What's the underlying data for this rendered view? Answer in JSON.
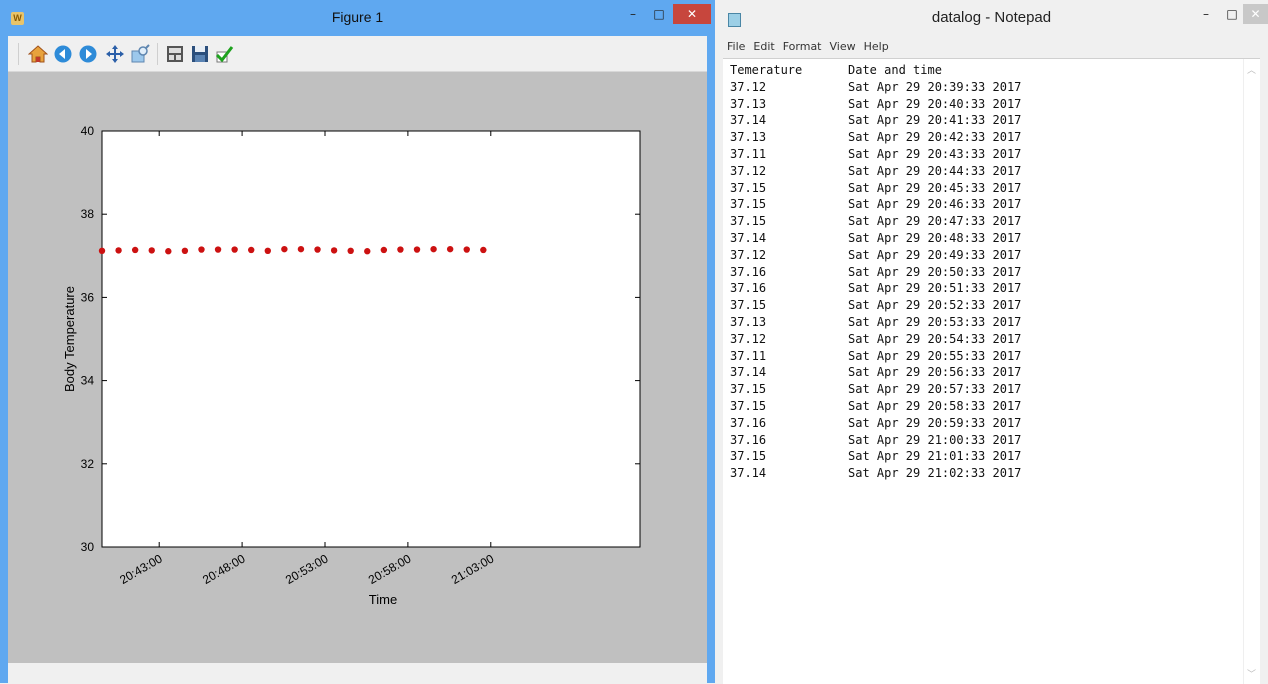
{
  "figure_window": {
    "title": "Figure 1",
    "app_icon_text": "W",
    "minimize": "–",
    "maximize": "□",
    "close": "✕",
    "toolbar": [
      {
        "name": "home-icon",
        "interactable": true
      },
      {
        "name": "back-icon",
        "interactable": true
      },
      {
        "name": "forward-icon",
        "interactable": true
      },
      {
        "name": "pan-icon",
        "interactable": true
      },
      {
        "name": "zoom-icon",
        "interactable": true
      },
      {
        "name": "subplots-icon",
        "interactable": true
      },
      {
        "name": "save-icon",
        "interactable": true
      },
      {
        "name": "edit-check-icon",
        "interactable": true
      }
    ]
  },
  "chart_data": {
    "type": "scatter",
    "title": "",
    "xlabel": "Time",
    "ylabel": "Body Temperature",
    "ylim": [
      30,
      40
    ],
    "yticks": [
      30,
      32,
      34,
      36,
      38,
      40
    ],
    "xlim": [
      "20:39:33",
      "21:12:00"
    ],
    "xticks": [
      "20:43:00",
      "20:48:00",
      "20:53:00",
      "20:58:00",
      "21:03:00"
    ],
    "grid": false,
    "marker_color": "#cc1111",
    "series": [
      {
        "x": [
          "20:39:33",
          "20:40:33",
          "20:41:33",
          "20:42:33",
          "20:43:33",
          "20:44:33",
          "20:45:33",
          "20:46:33",
          "20:47:33",
          "20:48:33",
          "20:49:33",
          "20:50:33",
          "20:51:33",
          "20:52:33",
          "20:53:33",
          "20:54:33",
          "20:55:33",
          "20:56:33",
          "20:57:33",
          "20:58:33",
          "20:59:33",
          "21:00:33",
          "21:01:33",
          "21:02:33"
        ],
        "y": [
          37.12,
          37.13,
          37.14,
          37.13,
          37.11,
          37.12,
          37.15,
          37.15,
          37.15,
          37.14,
          37.12,
          37.16,
          37.16,
          37.15,
          37.13,
          37.12,
          37.11,
          37.14,
          37.15,
          37.15,
          37.16,
          37.16,
          37.15,
          37.14
        ]
      }
    ]
  },
  "notepad": {
    "title": "datalog - Notepad",
    "minimize": "–",
    "maximize": "□",
    "close": "✕",
    "menu": [
      "File",
      "Edit",
      "Format",
      "View",
      "Help"
    ],
    "header": [
      "Temerature",
      "Date and time"
    ],
    "rows": [
      [
        "37.12",
        "Sat Apr 29 20:39:33 2017"
      ],
      [
        "37.13",
        "Sat Apr 29 20:40:33 2017"
      ],
      [
        "37.14",
        "Sat Apr 29 20:41:33 2017"
      ],
      [
        "37.13",
        "Sat Apr 29 20:42:33 2017"
      ],
      [
        "37.11",
        "Sat Apr 29 20:43:33 2017"
      ],
      [
        "37.12",
        "Sat Apr 29 20:44:33 2017"
      ],
      [
        "37.15",
        "Sat Apr 29 20:45:33 2017"
      ],
      [
        "37.15",
        "Sat Apr 29 20:46:33 2017"
      ],
      [
        "37.15",
        "Sat Apr 29 20:47:33 2017"
      ],
      [
        "37.14",
        "Sat Apr 29 20:48:33 2017"
      ],
      [
        "37.12",
        "Sat Apr 29 20:49:33 2017"
      ],
      [
        "37.16",
        "Sat Apr 29 20:50:33 2017"
      ],
      [
        "37.16",
        "Sat Apr 29 20:51:33 2017"
      ],
      [
        "37.15",
        "Sat Apr 29 20:52:33 2017"
      ],
      [
        "37.13",
        "Sat Apr 29 20:53:33 2017"
      ],
      [
        "37.12",
        "Sat Apr 29 20:54:33 2017"
      ],
      [
        "37.11",
        "Sat Apr 29 20:55:33 2017"
      ],
      [
        "37.14",
        "Sat Apr 29 20:56:33 2017"
      ],
      [
        "37.15",
        "Sat Apr 29 20:57:33 2017"
      ],
      [
        "37.15",
        "Sat Apr 29 20:58:33 2017"
      ],
      [
        "37.16",
        "Sat Apr 29 20:59:33 2017"
      ],
      [
        "37.16",
        "Sat Apr 29 21:00:33 2017"
      ],
      [
        "37.15",
        "Sat Apr 29 21:01:33 2017"
      ],
      [
        "37.14",
        "Sat Apr 29 21:02:33 2017"
      ]
    ]
  }
}
